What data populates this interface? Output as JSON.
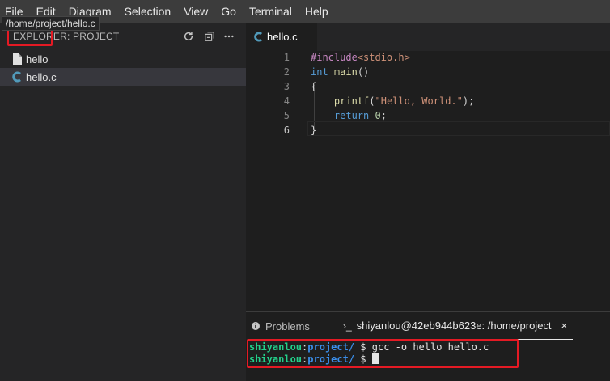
{
  "menu": [
    "File",
    "Edit",
    "Diagram",
    "Selection",
    "View",
    "Go",
    "Terminal",
    "Help"
  ],
  "tooltip": "/home/project/hello.c",
  "sidebar": {
    "title": "EXPLORER: PROJECT",
    "actions": [
      "refresh-icon",
      "collapse-all-icon",
      "more-icon"
    ],
    "files": [
      {
        "name": "hello",
        "icon": "file-icon"
      },
      {
        "name": "hello.c",
        "icon": "c-file-icon"
      }
    ]
  },
  "editor": {
    "tab": "hello.c",
    "lines": [
      {
        "num": "1",
        "tokens": [
          [
            "kw-inc",
            "#include"
          ],
          [
            "str",
            "<stdio.h>"
          ]
        ]
      },
      {
        "num": "2",
        "tokens": [
          [
            "kw",
            "int"
          ],
          [
            "plain",
            " "
          ],
          [
            "fn",
            "main"
          ],
          [
            "plain",
            "()"
          ]
        ]
      },
      {
        "num": "3",
        "tokens": [
          [
            "plain",
            "{"
          ]
        ]
      },
      {
        "num": "4",
        "tokens": [
          [
            "plain",
            "    "
          ],
          [
            "fn",
            "printf"
          ],
          [
            "plain",
            "("
          ],
          [
            "str",
            "\"Hello, World.\""
          ],
          [
            "plain",
            ");"
          ]
        ]
      },
      {
        "num": "5",
        "tokens": [
          [
            "plain",
            "    "
          ],
          [
            "kw",
            "return"
          ],
          [
            "plain",
            " "
          ],
          [
            "num",
            "0"
          ],
          [
            "plain",
            ";"
          ]
        ]
      },
      {
        "num": "6",
        "tokens": [
          [
            "plain",
            "}"
          ]
        ]
      }
    ]
  },
  "panel": {
    "problems_label": "Problems",
    "terminal_label": "shiyanlou@42eb944b623e: /home/project",
    "terminal_lines": [
      {
        "user": "shiyanlou",
        "path": "project/",
        "prompt": " $ ",
        "command": "gcc -o hello hello.c"
      },
      {
        "user": "shiyanlou",
        "path": "project/",
        "prompt": " $ ",
        "command": ""
      }
    ]
  },
  "colors": {
    "accent_highlight": "#e51a24",
    "c_icon": "#519aba"
  }
}
